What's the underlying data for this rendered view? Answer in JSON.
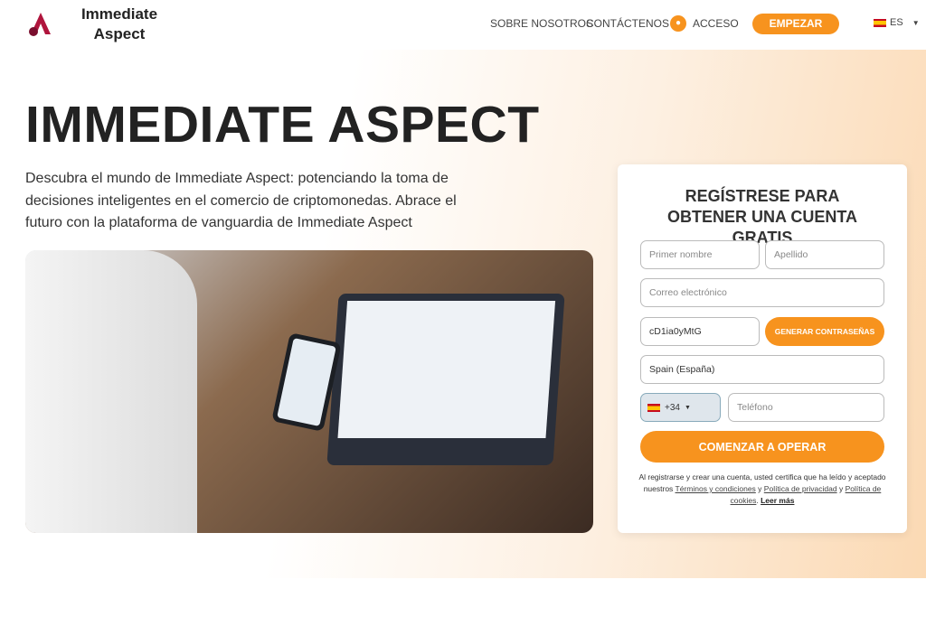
{
  "header": {
    "brand": "Immediate Aspect",
    "nav": [
      "SOBRE NOSOTROS",
      "CONTÁCTENOS"
    ],
    "login": "ACCESO",
    "cta": "EMPEZAR",
    "lang": "ES"
  },
  "hero": {
    "title": "IMMEDIATE ASPECT",
    "description": "Descubra el mundo de Immediate Aspect: potenciando la toma de decisiones inteligentes en el comercio de criptomonedas. Abrace el futuro con la plataforma de vanguardia de Immediate Aspect"
  },
  "form": {
    "title": "REGÍSTRESE PARA OBTENER UNA CUENTA GRATIS",
    "first_name": "Primer nombre",
    "last_name": "Apellido",
    "email": "Correo electrónico",
    "password": "cD1ia0yMtG",
    "generate": "GENERAR CONTRASEÑAS",
    "country": "Spain (España)",
    "dial_code": "+34",
    "phone": "Teléfono",
    "submit": "COMENZAR A OPERAR",
    "legal": {
      "text1": "Al registrarse y crear una cuenta, usted certifica que ha leído y aceptado nuestros ",
      "terms": "Términos y condiciones",
      "and": " y ",
      "privacy": "Política de privacidad",
      "and2": " y ",
      "cookies": "Política de cookies",
      "dot": ". ",
      "more": "Leer más"
    }
  },
  "colors": {
    "accent": "#f7931e",
    "logo": "#b0153d"
  }
}
